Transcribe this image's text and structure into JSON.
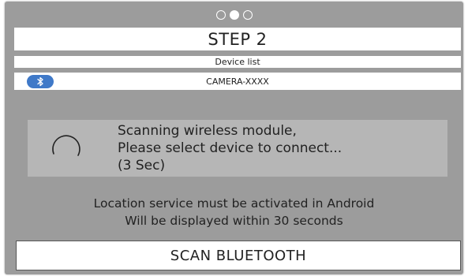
{
  "pager": {
    "total": 3,
    "active_index": 1
  },
  "step": {
    "title": "STEP 2"
  },
  "device_list": {
    "header": "Device list",
    "items": [
      {
        "icon": "bluetooth-icon",
        "name": "CAMERA-XXXX"
      }
    ]
  },
  "scanning": {
    "line1": "Scanning wireless module,",
    "line2": "Please select device to connect...",
    "line3": "(3 Sec)"
  },
  "notice": {
    "line1": "Location service must be activated in Android",
    "line2": "Will be displayed within 30 seconds"
  },
  "actions": {
    "scan_label": "SCAN BLUETOOTH"
  },
  "colors": {
    "frame_background": "#9c9c9c",
    "scan_panel": "#b6b6b6",
    "bluetooth_badge": "#3f79c8"
  }
}
